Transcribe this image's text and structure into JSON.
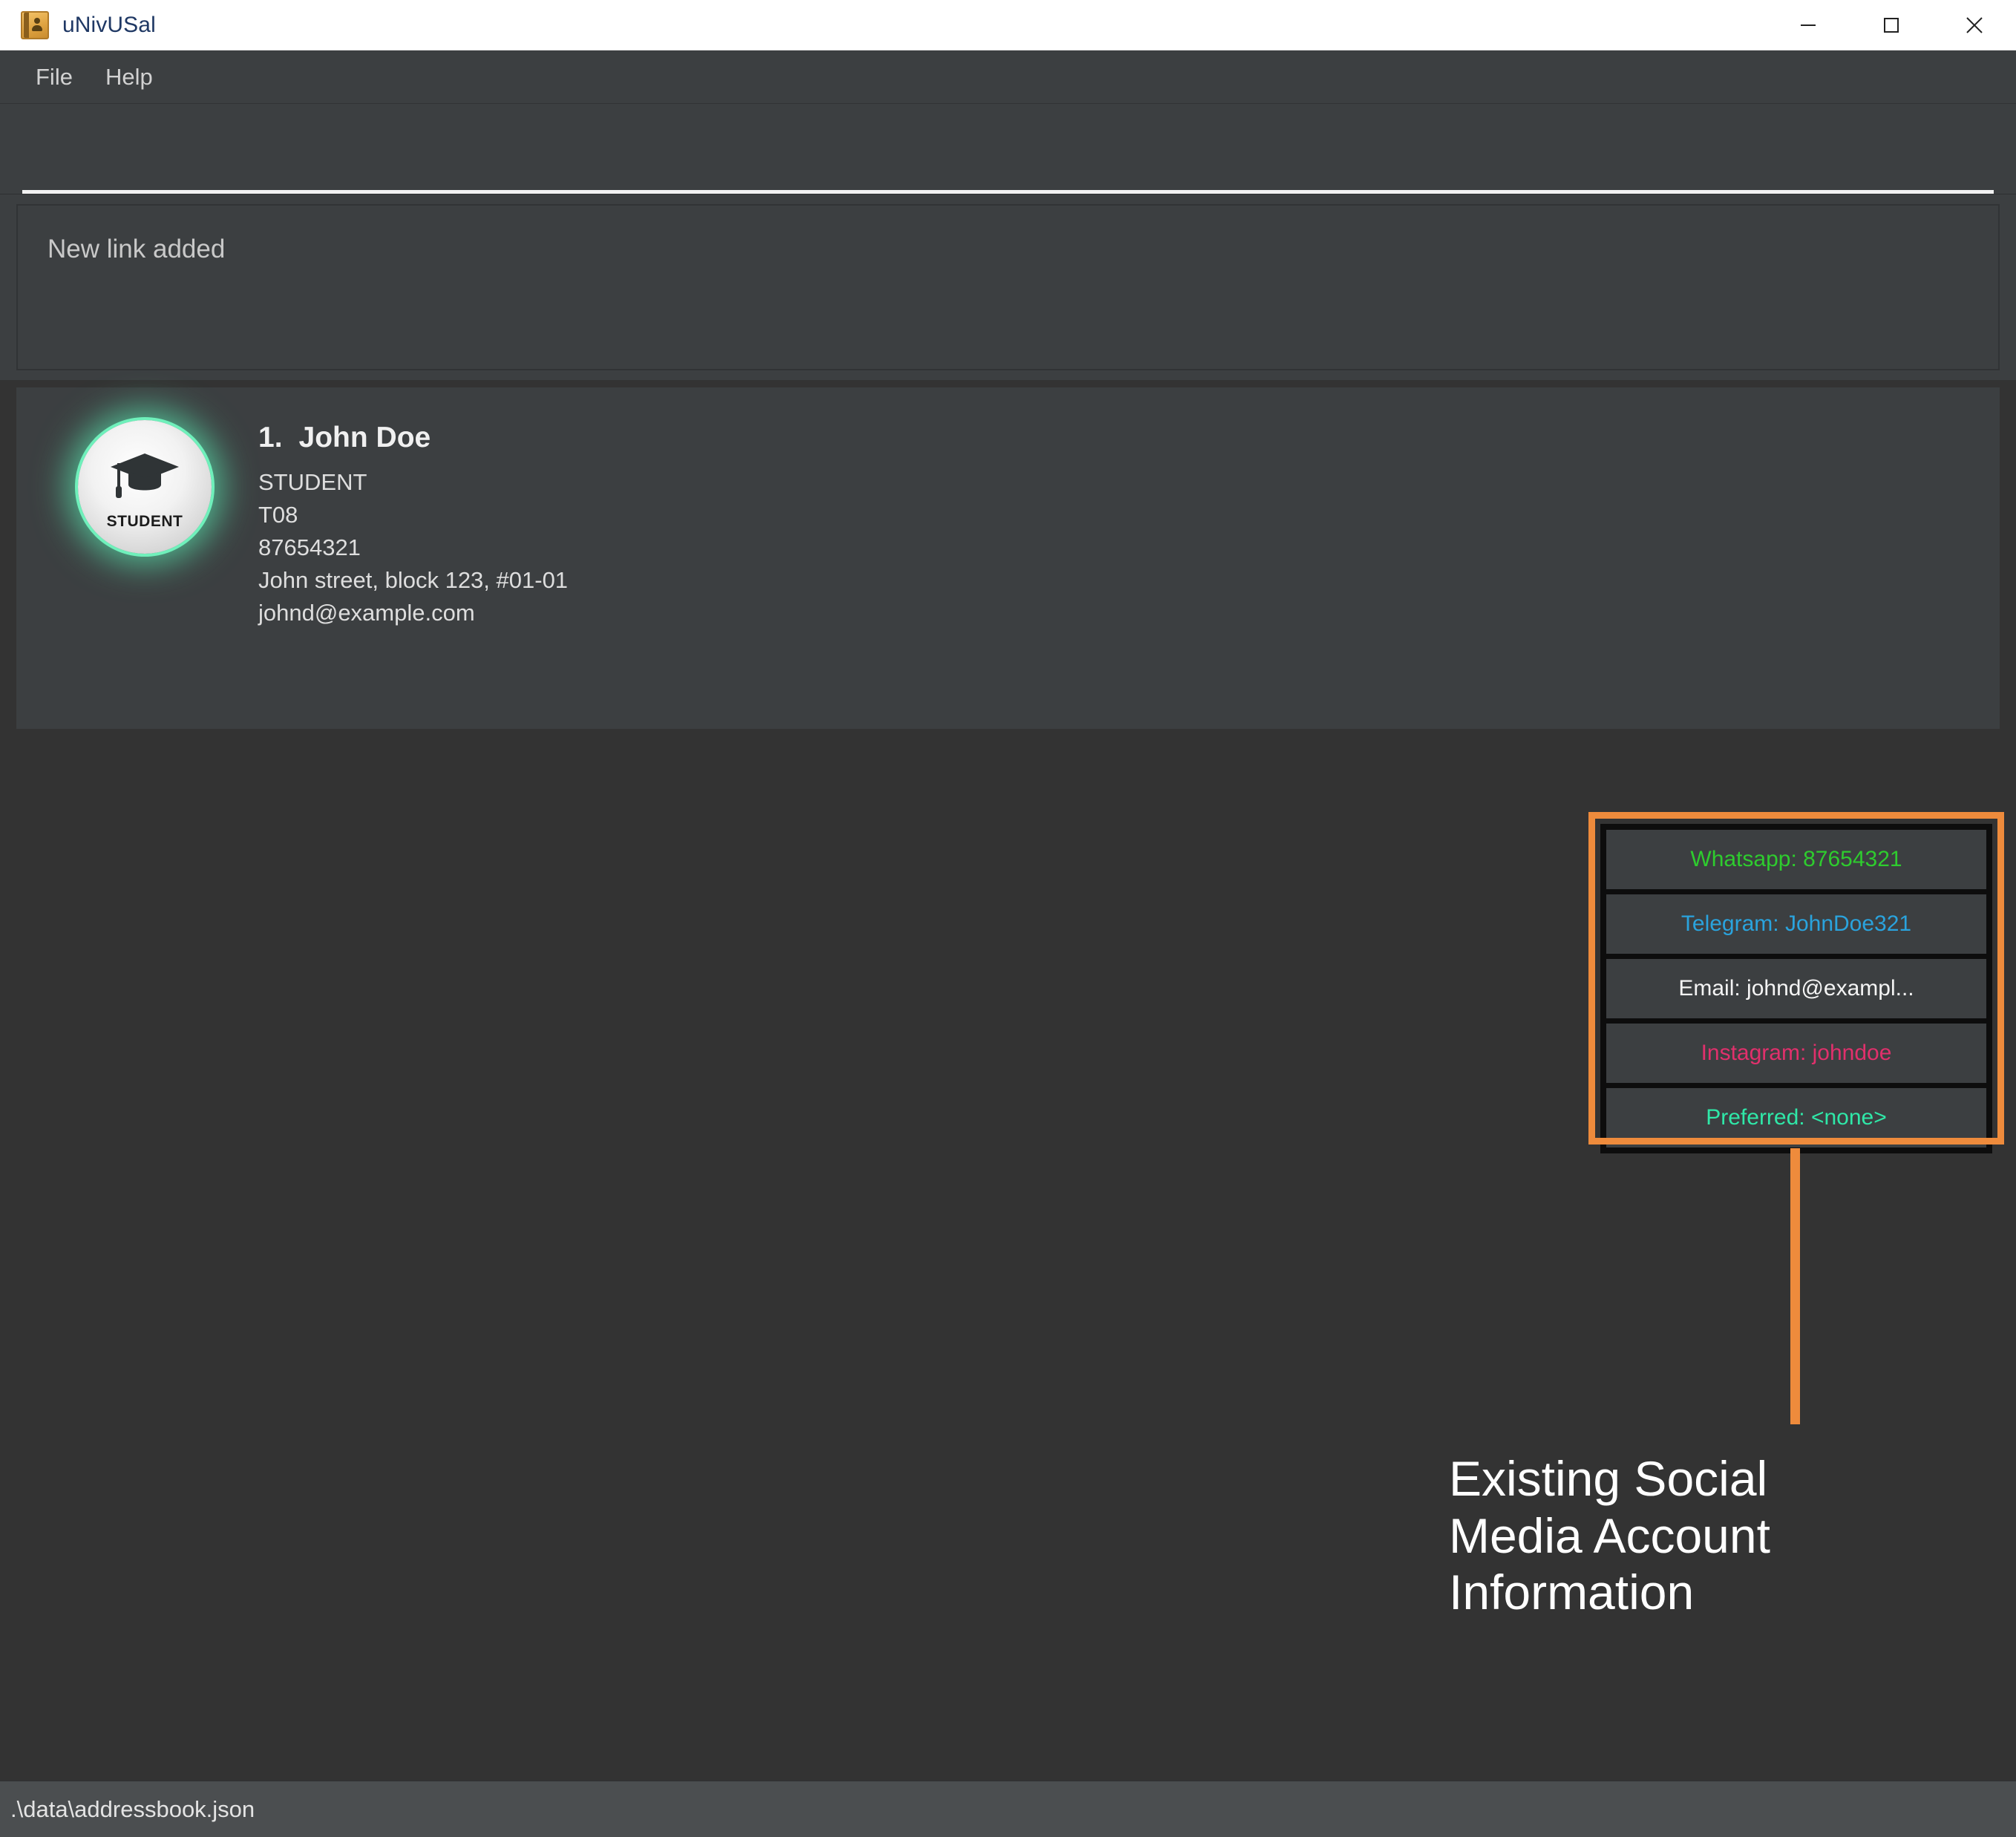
{
  "window": {
    "title": "uNivUSal",
    "icon": "addressbook-icon",
    "controls": {
      "minimize": "minimize-button",
      "maximize": "maximize-button",
      "close": "close-button"
    }
  },
  "menu": {
    "items": [
      {
        "label": "File"
      },
      {
        "label": "Help"
      }
    ]
  },
  "command": {
    "value": "",
    "placeholder": ""
  },
  "result": {
    "text": "New link added"
  },
  "person": {
    "index": "1.",
    "name": "John Doe",
    "avatar": {
      "icon": "graduation-cap-icon",
      "label": "STUDENT",
      "glow_color": "#6ff0bb"
    },
    "fields": [
      "STUDENT",
      "T08",
      "87654321",
      "John street, block 123, #01-01",
      "johnd@example.com"
    ],
    "social": [
      {
        "name": "whatsapp",
        "label": "Whatsapp: 87654321",
        "color": "#2ecc2e"
      },
      {
        "name": "telegram",
        "label": "Telegram: JohnDoe321",
        "color": "#2aa3dd"
      },
      {
        "name": "email",
        "label": "Email: johnd@exampl...",
        "color": "#f4f4f4"
      },
      {
        "name": "instagram",
        "label": "Instagram: johndoe",
        "color": "#e1306c"
      },
      {
        "name": "preferred",
        "label": "Preferred: <none>",
        "color": "#2fe8a8"
      }
    ]
  },
  "annotation": {
    "text": "Existing Social Media Account Information",
    "color": "#ee8b3c"
  },
  "status": {
    "path": ".\\data\\addressbook.json"
  }
}
